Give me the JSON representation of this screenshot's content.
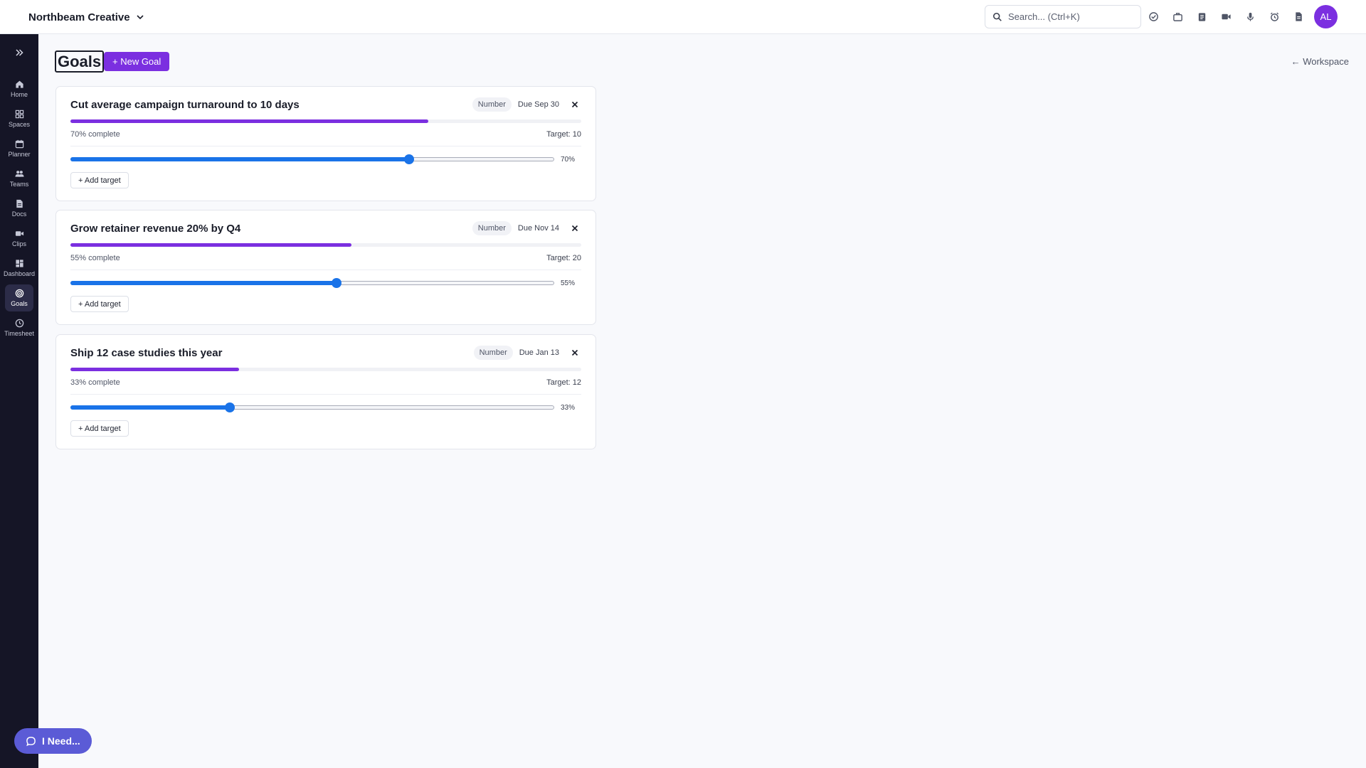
{
  "workspace": {
    "name": "Northbeam Creative"
  },
  "search": {
    "placeholder": "Search... (Ctrl+K)",
    "value": ""
  },
  "toolbar": {
    "icons": [
      "check-circle-icon",
      "briefcase-icon",
      "clipboard-icon",
      "video-icon",
      "microphone-icon",
      "alarm-icon",
      "document-icon"
    ]
  },
  "user": {
    "initials": "AL",
    "avatar_color": "#7b2fe0"
  },
  "sidebar": {
    "items": [
      {
        "label": "Home",
        "icon": "home-icon",
        "active": false
      },
      {
        "label": "Spaces",
        "icon": "grid-icon",
        "active": false
      },
      {
        "label": "Planner",
        "icon": "calendar-icon",
        "active": false
      },
      {
        "label": "Teams",
        "icon": "people-icon",
        "active": false
      },
      {
        "label": "Docs",
        "icon": "doc-icon",
        "active": false
      },
      {
        "label": "Clips",
        "icon": "video-icon",
        "active": false
      },
      {
        "label": "Dashboard",
        "icon": "dashboard-icon",
        "active": false
      },
      {
        "label": "Goals",
        "icon": "target-icon",
        "active": true
      },
      {
        "label": "Timesheet",
        "icon": "clock-icon",
        "active": false
      }
    ]
  },
  "page": {
    "title": "Goals",
    "new_goal_label": "+ New Goal",
    "back_label": "← Workspace"
  },
  "goals": [
    {
      "title": "Cut average campaign turnaround to 10 days",
      "type": "Number",
      "due": "Due Sep 30",
      "progress": 70,
      "complete_label": "70% complete",
      "target_label": "Target: 10",
      "slider_label": "70%",
      "add_target_label": "+ Add target"
    },
    {
      "title": "Grow retainer revenue 20% by Q4",
      "type": "Number",
      "due": "Due Nov 14",
      "progress": 55,
      "complete_label": "55% complete",
      "target_label": "Target: 20",
      "slider_label": "55%",
      "add_target_label": "+ Add target"
    },
    {
      "title": "Ship 12 case studies this year",
      "type": "Number",
      "due": "Due Jan 13",
      "progress": 33,
      "complete_label": "33% complete",
      "target_label": "Target: 12",
      "slider_label": "33%",
      "add_target_label": "+ Add target"
    }
  ],
  "help": {
    "label": "I Need..."
  },
  "colors": {
    "accent": "#7b2fe0",
    "slider": "#1a73e8",
    "sidebar_bg": "#151526",
    "help_bg": "#5b5bd6"
  }
}
